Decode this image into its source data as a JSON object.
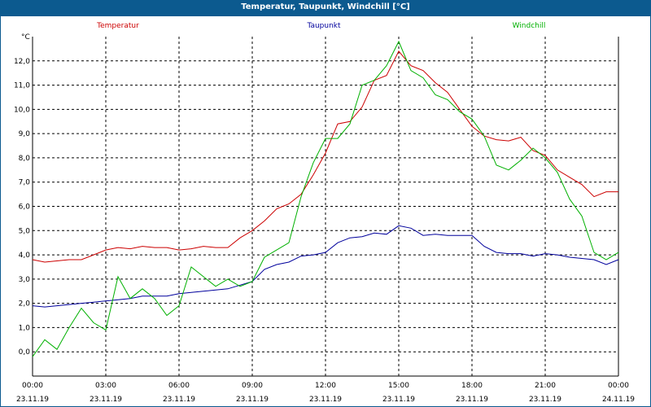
{
  "window": {
    "title": "Temperatur, Taupunkt, Windchill [°C]"
  },
  "chart_data": {
    "type": "line",
    "title": "Temperatur, Taupunkt, Windchill [°C]",
    "ylabel": "°C",
    "ylim": [
      -1,
      13
    ],
    "yticks": [
      0.0,
      1.0,
      2.0,
      3.0,
      4.0,
      5.0,
      6.0,
      7.0,
      8.0,
      9.0,
      10.0,
      11.0,
      12.0
    ],
    "ytick_labels": [
      "0,0",
      "1,0",
      "2,0",
      "3,0",
      "4,0",
      "5,0",
      "6,0",
      "7,0",
      "8,0",
      "9,0",
      "10,0",
      "11,0",
      "12,0"
    ],
    "xlim": [
      0,
      24
    ],
    "xticks": [
      0,
      3,
      6,
      9,
      12,
      15,
      18,
      21,
      24
    ],
    "xtick_times": [
      "00:00",
      "03:00",
      "06:00",
      "09:00",
      "12:00",
      "15:00",
      "18:00",
      "21:00",
      "00:00"
    ],
    "xtick_dates": [
      "23.11.19",
      "23.11.19",
      "23.11.19",
      "23.11.19",
      "23.11.19",
      "23.11.19",
      "23.11.19",
      "23.11.19",
      "24.11.19"
    ],
    "grid": true,
    "legend": "top",
    "series": [
      {
        "name": "Temperatur",
        "color": "#cc0000",
        "x": [
          0,
          0.5,
          1,
          1.5,
          2,
          2.5,
          3,
          3.5,
          4,
          4.5,
          5,
          5.5,
          6,
          6.5,
          7,
          7.5,
          8,
          8.5,
          9,
          9.5,
          10,
          10.5,
          11,
          11.5,
          12,
          12.5,
          13,
          13.5,
          14,
          14.5,
          15,
          15.5,
          16,
          16.5,
          17,
          17.5,
          18,
          18.5,
          19,
          19.5,
          20,
          20.5,
          21,
          21.5,
          22,
          22.5,
          23,
          23.5,
          24
        ],
        "values": [
          3.8,
          3.7,
          3.75,
          3.8,
          3.8,
          4.0,
          4.2,
          4.3,
          4.25,
          4.35,
          4.3,
          4.3,
          4.2,
          4.25,
          4.35,
          4.3,
          4.3,
          4.7,
          5.0,
          5.4,
          5.9,
          6.1,
          6.5,
          7.3,
          8.2,
          9.4,
          9.5,
          10.1,
          11.2,
          11.4,
          12.4,
          11.8,
          11.6,
          11.1,
          10.7,
          10.0,
          9.3,
          8.9,
          8.75,
          8.7,
          8.85,
          8.3,
          8.1,
          7.5,
          7.2,
          6.9,
          6.4,
          6.6,
          6.6
        ]
      },
      {
        "name": "Taupunkt",
        "color": "#00009c",
        "x": [
          0,
          0.5,
          1,
          1.5,
          2,
          2.5,
          3,
          3.5,
          4,
          4.5,
          5,
          5.5,
          6,
          6.5,
          7,
          7.5,
          8,
          8.5,
          9,
          9.5,
          10,
          10.5,
          11,
          11.5,
          12,
          12.5,
          13,
          13.5,
          14,
          14.5,
          15,
          15.5,
          16,
          16.5,
          17,
          17.5,
          18,
          18.5,
          19,
          19.5,
          20,
          20.5,
          21,
          21.5,
          22,
          22.5,
          23,
          23.5,
          24
        ],
        "values": [
          1.9,
          1.85,
          1.9,
          1.95,
          2.0,
          2.05,
          2.1,
          2.15,
          2.2,
          2.3,
          2.3,
          2.3,
          2.4,
          2.45,
          2.5,
          2.55,
          2.6,
          2.75,
          2.9,
          3.4,
          3.6,
          3.7,
          3.95,
          4.0,
          4.1,
          4.5,
          4.7,
          4.75,
          4.9,
          4.85,
          5.2,
          5.1,
          4.8,
          4.85,
          4.8,
          4.8,
          4.8,
          4.35,
          4.1,
          4.05,
          4.05,
          3.95,
          4.05,
          4.0,
          3.9,
          3.85,
          3.8,
          3.6,
          3.8
        ]
      },
      {
        "name": "Windchill",
        "color": "#00b000",
        "x": [
          0,
          0.5,
          1,
          1.5,
          2,
          2.5,
          3,
          3.5,
          4,
          4.5,
          5,
          5.5,
          6,
          6.5,
          7,
          7.5,
          8,
          8.5,
          9,
          9.5,
          10,
          10.5,
          11,
          11.5,
          12,
          12.5,
          13,
          13.5,
          14,
          14.5,
          15,
          15.5,
          16,
          16.5,
          17,
          17.5,
          18,
          18.5,
          19,
          19.5,
          20,
          20.5,
          21,
          21.5,
          22,
          22.5,
          23,
          23.5,
          24
        ],
        "values": [
          -0.2,
          0.5,
          0.1,
          1.0,
          1.8,
          1.2,
          0.9,
          3.1,
          2.2,
          2.6,
          2.2,
          1.5,
          1.9,
          3.5,
          3.1,
          2.7,
          3.0,
          2.7,
          2.9,
          3.9,
          4.2,
          4.5,
          6.4,
          7.8,
          8.8,
          8.8,
          9.4,
          11.0,
          11.2,
          11.8,
          12.8,
          11.6,
          11.3,
          10.6,
          10.4,
          9.9,
          9.6,
          8.9,
          7.7,
          7.5,
          7.9,
          8.4,
          8.0,
          7.4,
          6.3,
          5.6,
          4.1,
          3.8,
          4.1
        ]
      }
    ]
  }
}
